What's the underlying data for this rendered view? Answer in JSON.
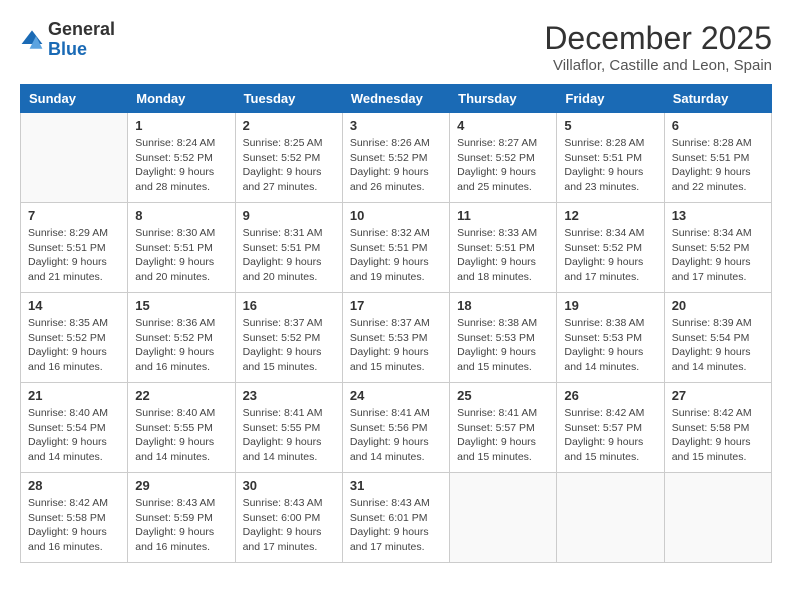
{
  "logo": {
    "general": "General",
    "blue": "Blue"
  },
  "header": {
    "title": "December 2025",
    "subtitle": "Villaflor, Castille and Leon, Spain"
  },
  "weekdays": [
    "Sunday",
    "Monday",
    "Tuesday",
    "Wednesday",
    "Thursday",
    "Friday",
    "Saturday"
  ],
  "weeks": [
    [
      {
        "day": "",
        "info": ""
      },
      {
        "day": "1",
        "info": "Sunrise: 8:24 AM\nSunset: 5:52 PM\nDaylight: 9 hours\nand 28 minutes."
      },
      {
        "day": "2",
        "info": "Sunrise: 8:25 AM\nSunset: 5:52 PM\nDaylight: 9 hours\nand 27 minutes."
      },
      {
        "day": "3",
        "info": "Sunrise: 8:26 AM\nSunset: 5:52 PM\nDaylight: 9 hours\nand 26 minutes."
      },
      {
        "day": "4",
        "info": "Sunrise: 8:27 AM\nSunset: 5:52 PM\nDaylight: 9 hours\nand 25 minutes."
      },
      {
        "day": "5",
        "info": "Sunrise: 8:28 AM\nSunset: 5:51 PM\nDaylight: 9 hours\nand 23 minutes."
      },
      {
        "day": "6",
        "info": "Sunrise: 8:28 AM\nSunset: 5:51 PM\nDaylight: 9 hours\nand 22 minutes."
      }
    ],
    [
      {
        "day": "7",
        "info": "Sunrise: 8:29 AM\nSunset: 5:51 PM\nDaylight: 9 hours\nand 21 minutes."
      },
      {
        "day": "8",
        "info": "Sunrise: 8:30 AM\nSunset: 5:51 PM\nDaylight: 9 hours\nand 20 minutes."
      },
      {
        "day": "9",
        "info": "Sunrise: 8:31 AM\nSunset: 5:51 PM\nDaylight: 9 hours\nand 20 minutes."
      },
      {
        "day": "10",
        "info": "Sunrise: 8:32 AM\nSunset: 5:51 PM\nDaylight: 9 hours\nand 19 minutes."
      },
      {
        "day": "11",
        "info": "Sunrise: 8:33 AM\nSunset: 5:51 PM\nDaylight: 9 hours\nand 18 minutes."
      },
      {
        "day": "12",
        "info": "Sunrise: 8:34 AM\nSunset: 5:52 PM\nDaylight: 9 hours\nand 17 minutes."
      },
      {
        "day": "13",
        "info": "Sunrise: 8:34 AM\nSunset: 5:52 PM\nDaylight: 9 hours\nand 17 minutes."
      }
    ],
    [
      {
        "day": "14",
        "info": "Sunrise: 8:35 AM\nSunset: 5:52 PM\nDaylight: 9 hours\nand 16 minutes."
      },
      {
        "day": "15",
        "info": "Sunrise: 8:36 AM\nSunset: 5:52 PM\nDaylight: 9 hours\nand 16 minutes."
      },
      {
        "day": "16",
        "info": "Sunrise: 8:37 AM\nSunset: 5:52 PM\nDaylight: 9 hours\nand 15 minutes."
      },
      {
        "day": "17",
        "info": "Sunrise: 8:37 AM\nSunset: 5:53 PM\nDaylight: 9 hours\nand 15 minutes."
      },
      {
        "day": "18",
        "info": "Sunrise: 8:38 AM\nSunset: 5:53 PM\nDaylight: 9 hours\nand 15 minutes."
      },
      {
        "day": "19",
        "info": "Sunrise: 8:38 AM\nSunset: 5:53 PM\nDaylight: 9 hours\nand 14 minutes."
      },
      {
        "day": "20",
        "info": "Sunrise: 8:39 AM\nSunset: 5:54 PM\nDaylight: 9 hours\nand 14 minutes."
      }
    ],
    [
      {
        "day": "21",
        "info": "Sunrise: 8:40 AM\nSunset: 5:54 PM\nDaylight: 9 hours\nand 14 minutes."
      },
      {
        "day": "22",
        "info": "Sunrise: 8:40 AM\nSunset: 5:55 PM\nDaylight: 9 hours\nand 14 minutes."
      },
      {
        "day": "23",
        "info": "Sunrise: 8:41 AM\nSunset: 5:55 PM\nDaylight: 9 hours\nand 14 minutes."
      },
      {
        "day": "24",
        "info": "Sunrise: 8:41 AM\nSunset: 5:56 PM\nDaylight: 9 hours\nand 14 minutes."
      },
      {
        "day": "25",
        "info": "Sunrise: 8:41 AM\nSunset: 5:57 PM\nDaylight: 9 hours\nand 15 minutes."
      },
      {
        "day": "26",
        "info": "Sunrise: 8:42 AM\nSunset: 5:57 PM\nDaylight: 9 hours\nand 15 minutes."
      },
      {
        "day": "27",
        "info": "Sunrise: 8:42 AM\nSunset: 5:58 PM\nDaylight: 9 hours\nand 15 minutes."
      }
    ],
    [
      {
        "day": "28",
        "info": "Sunrise: 8:42 AM\nSunset: 5:58 PM\nDaylight: 9 hours\nand 16 minutes."
      },
      {
        "day": "29",
        "info": "Sunrise: 8:43 AM\nSunset: 5:59 PM\nDaylight: 9 hours\nand 16 minutes."
      },
      {
        "day": "30",
        "info": "Sunrise: 8:43 AM\nSunset: 6:00 PM\nDaylight: 9 hours\nand 17 minutes."
      },
      {
        "day": "31",
        "info": "Sunrise: 8:43 AM\nSunset: 6:01 PM\nDaylight: 9 hours\nand 17 minutes."
      },
      {
        "day": "",
        "info": ""
      },
      {
        "day": "",
        "info": ""
      },
      {
        "day": "",
        "info": ""
      }
    ]
  ]
}
